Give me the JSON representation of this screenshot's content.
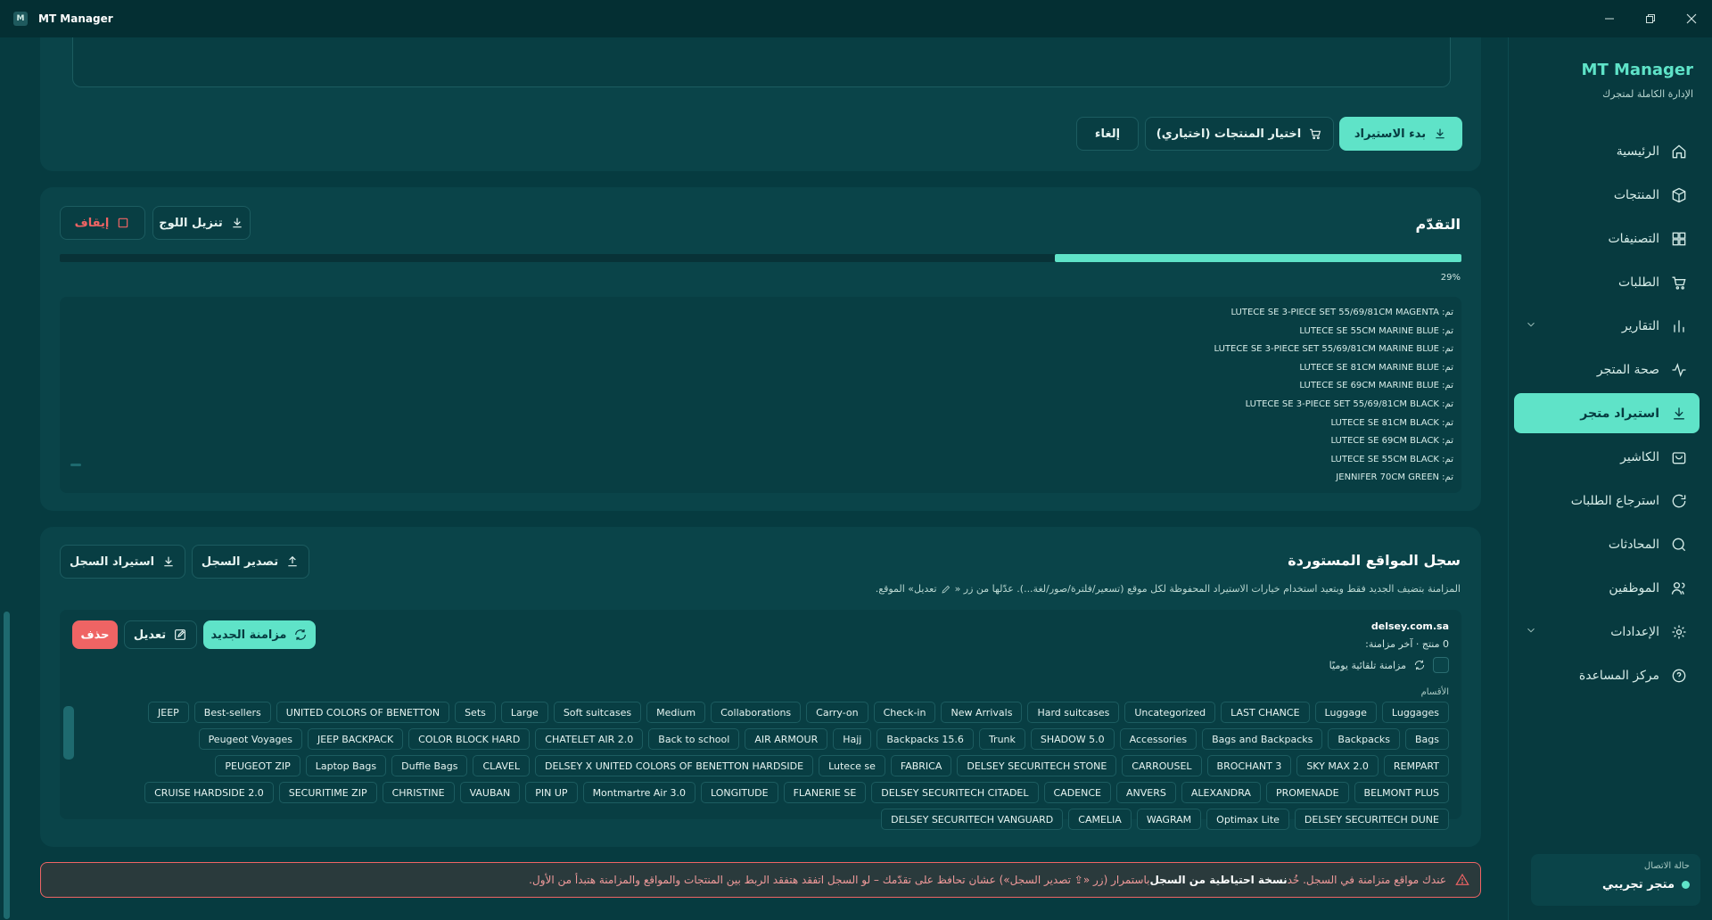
{
  "window": {
    "title": "MT Manager",
    "logo": "M"
  },
  "sidebar": {
    "brand": "MT Manager",
    "subtitle": "الإدارة الكاملة لمتجرك",
    "items": [
      {
        "label": "الرئيسية",
        "icon": "home-icon"
      },
      {
        "label": "المنتجات",
        "icon": "box-icon"
      },
      {
        "label": "التصنيفات",
        "icon": "grid-icon"
      },
      {
        "label": "الطلبات",
        "icon": "cart-icon"
      },
      {
        "label": "التقارير",
        "icon": "bar-chart-icon"
      },
      {
        "label": "صحة المتجر",
        "icon": "pulse-icon"
      },
      {
        "label": "استيراد متجر",
        "icon": "download-icon"
      },
      {
        "label": "الكاشير",
        "icon": "bag-icon"
      },
      {
        "label": "استرجاع الطلبات",
        "icon": "refresh-icon"
      },
      {
        "label": "المحادثات",
        "icon": "chat-icon"
      },
      {
        "label": "الموظفين",
        "icon": "users-icon"
      },
      {
        "label": "الإعدادات",
        "icon": "gear-icon"
      },
      {
        "label": "مركز المساعدة",
        "icon": "help-icon"
      }
    ],
    "connection": {
      "label": "حالة الاتصال",
      "value": "متجر تجريبي",
      "color": "#5fe3c8"
    }
  },
  "import_actions": {
    "start": "بدء الاستيراد",
    "select_products": "اختيار المنتجات (اختياري)",
    "cancel": "إلغاء"
  },
  "progress": {
    "title": "التقدّم",
    "percent_label": "29%",
    "percent_value": 0.29,
    "download_log": "تنزيل اللوج",
    "stop": "إيقاف",
    "log": [
      "تم: LUTECE SE 3-PIECE SET 55/69/81CM MAGENTA",
      "تم: LUTECE SE 55CM MARINE BLUE",
      "تم: LUTECE SE 3-PIECE SET 55/69/81CM MARINE BLUE",
      "تم: LUTECE SE 81CM MARINE BLUE",
      "تم: LUTECE SE 69CM MARINE BLUE",
      "تم: LUTECE SE 3-PIECE SET 55/69/81CM BLACK",
      "تم: LUTECE SE 81CM BLACK",
      "تم: LUTECE SE 69CM BLACK",
      "تم: LUTECE SE 55CM BLACK",
      "تم: JENNIFER 70CM GREEN"
    ]
  },
  "sites": {
    "title": "سجل المواقع المستوردة",
    "export": "تصدير السجل",
    "import": "استيراد السجل",
    "description": "المزامنة بتضيف الجديد فقط وبتعيد استخدام خيارات الاستيراد المحفوظة لكل موقع (تسعير/فلترة/صور/لغة...). عدّلها من زر «",
    "description_end": "تعديل» الموقع.",
    "site": {
      "name": "delsey.com.sa",
      "meta": "0 منتج · آخر مزامنة:",
      "auto_sync": "مزامنة تلقائية يوميًا",
      "sync": "مزامنة الجديد",
      "edit": "تعديل",
      "delete": "حذف",
      "categories_label": "الأقسام",
      "categories": [
        "Luggages",
        "Luggage",
        "LAST CHANCE",
        "Uncategorized",
        "Hard suitcases",
        "New Arrivals",
        "Check-in",
        "Carry-on",
        "Collaborations",
        "Medium",
        "Soft suitcases",
        "Large",
        "Sets",
        "UNITED COLORS OF BENETTON",
        "Best-sellers",
        "JEEP",
        "Bags",
        "Backpacks",
        "Bags and Backpacks",
        "Accessories",
        "SHADOW 5.0",
        "Trunk",
        "Backpacks 15.6",
        "Hajj",
        "AIR ARMOUR",
        "Back to school",
        "CHATELET AIR 2.0",
        "COLOR BLOCK HARD",
        "JEEP BACKPACK",
        "Peugeot Voyages",
        "REMPART",
        "SKY MAX 2.0",
        "BROCHANT 3",
        "CARROUSEL",
        "DELSEY SECURITECH STONE",
        "FABRICA",
        "Lutece se",
        "DELSEY X UNITED COLORS OF BENETTON HARDSIDE",
        "CLAVEL",
        "Duffle Bags",
        "Laptop Bags",
        "PEUGEOT ZIP",
        "BELMONT PLUS",
        "PROMENADE",
        "ALEXANDRA",
        "ANVERS",
        "CADENCE",
        "DELSEY SECURITECH CITADEL",
        "FLANERIE SE",
        "LONGITUDE",
        "Montmartre Air 3.0",
        "PIN UP",
        "VAUBAN",
        "CHRISTINE",
        "SECURITIME ZIP",
        "CRUISE HARDSIDE 2.0",
        "DELSEY SECURITECH DUNE",
        "Optimax Lite",
        "WAGRAM",
        "CAMELIA",
        "DELSEY SECURITECH VANGUARD"
      ]
    }
  },
  "alert": {
    "part1": "عندك مواقع متزامنة في السجل. خُد ",
    "bold": "نسخة احتياطية من السجل",
    "part2": " باستمرار (زر «⇪ تصدير السجل») عشان تحافظ على تقدّمك – لو السجل اتفقد هتفقد الربط بين المنتجات والمواقع والمزامنة هتبدأ من الأول."
  },
  "colors": {
    "accent": "#5fe3c8",
    "danger": "#ef6464",
    "background": "#063b40",
    "card": "#0a4449"
  }
}
